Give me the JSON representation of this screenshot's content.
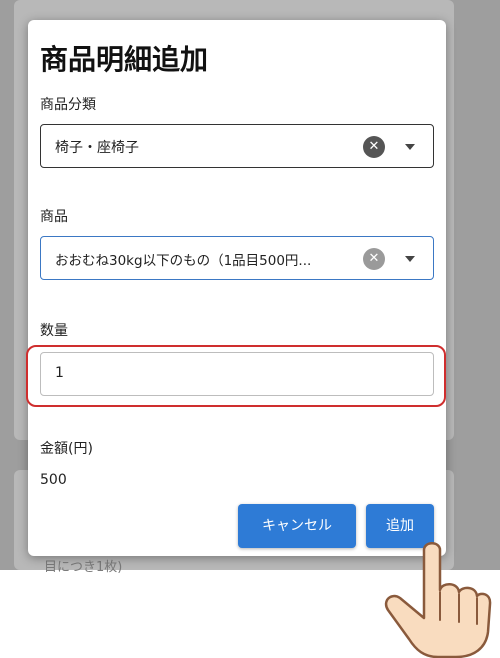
{
  "dialog": {
    "title": "商品明細追加",
    "category_label": "商品分類",
    "category_value": "椅子・座椅子",
    "product_label": "商品",
    "product_value": "おおむね30kg以下のもの（1品目500円...",
    "quantity_label": "数量",
    "quantity_value": "1",
    "amount_label": "金額(円)",
    "amount_value": "500",
    "cancel_label": "キャンセル",
    "add_label": "追加"
  },
  "background": {
    "partial_text": "目につき1枚)"
  },
  "colors": {
    "primary_button": "#2e7bd6",
    "focus_border": "#3b78c4",
    "highlight": "#cf2e2e",
    "overlay": "#9e9e9e"
  },
  "icons": [
    "clear-icon",
    "chevron-down-icon",
    "pointing-hand-icon"
  ]
}
